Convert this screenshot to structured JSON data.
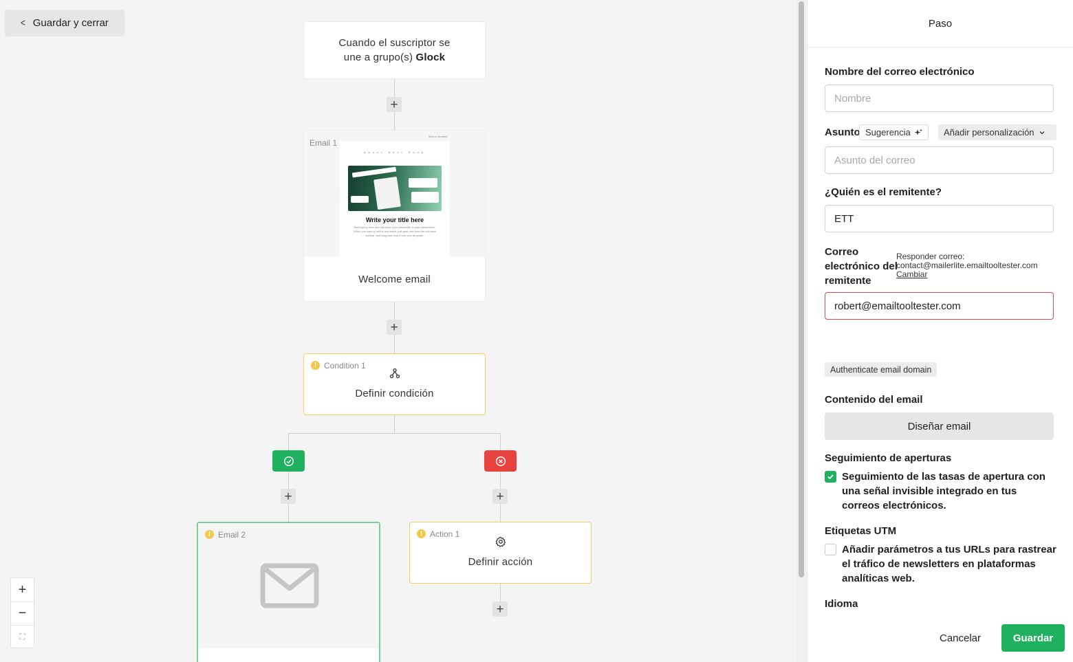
{
  "topbar": {
    "back_label": "Guardar y cerrar"
  },
  "trigger": {
    "text_prefix": "Cuando el suscriptor se une a grupo(s)",
    "group_name": "Glock"
  },
  "email1": {
    "tag": "Email 1",
    "label": "Welcome email",
    "preview": {
      "nav": "About Next Shop",
      "corner": "View in browser",
      "title": "Write your title here",
      "body": "Start typing here and introduce your newsletter to your subscribers. When you want to add a new block, just grab one from the left-hand sidebar, and drag and drop it into your template."
    }
  },
  "condition": {
    "tag": "Condition 1",
    "label": "Definir condición"
  },
  "email2": {
    "tag": "Email 2"
  },
  "action": {
    "tag": "Action 1",
    "label": "Definir acción"
  },
  "zoom": {
    "in": "+",
    "out": "−",
    "fit": "⛶"
  },
  "panel": {
    "title": "Paso",
    "name_label": "Nombre del correo electrónico",
    "name_placeholder": "Nombre",
    "subject_label": "Asunto",
    "suggest_chip": "Sugerencia",
    "personalize_chip": "Añadir personalización",
    "subject_placeholder": "Asunto del correo",
    "sender_label": "¿Quién es el remitente?",
    "sender_value": "ETT",
    "sender_email_label_1": "Correo",
    "sender_email_label_2": "electrónico del",
    "sender_email_label_3": "remitente",
    "reply_label": "Responder correo:",
    "reply_email": "contact@mailerlite.emailtooltester.com",
    "reply_change": "Cambiar",
    "sender_email_value": "robert@emailtooltester.com",
    "auth_chip": "Authenticate email domain",
    "content_label": "Contenido del email",
    "design_button": "Diseñar email",
    "open_tracking_label": "Seguimiento de aperturas",
    "open_tracking_text": "Seguimiento de las tasas de apertura con una señal invisible integrado en tus correos electrónicos.",
    "open_tracking_checked": true,
    "utm_label": "Etiquetas UTM",
    "utm_text": "Añadir parámetros a tus URLs para rastrear el tráfico de newsletters en plataformas analíticas web.",
    "utm_checked": false,
    "language_label": "Idioma",
    "cancel_button": "Cancelar",
    "save_button": "Guardar"
  },
  "colors": {
    "accent_green": "#1fb15e",
    "error_red": "#e8423f",
    "warning_yellow": "#f4c84a"
  }
}
